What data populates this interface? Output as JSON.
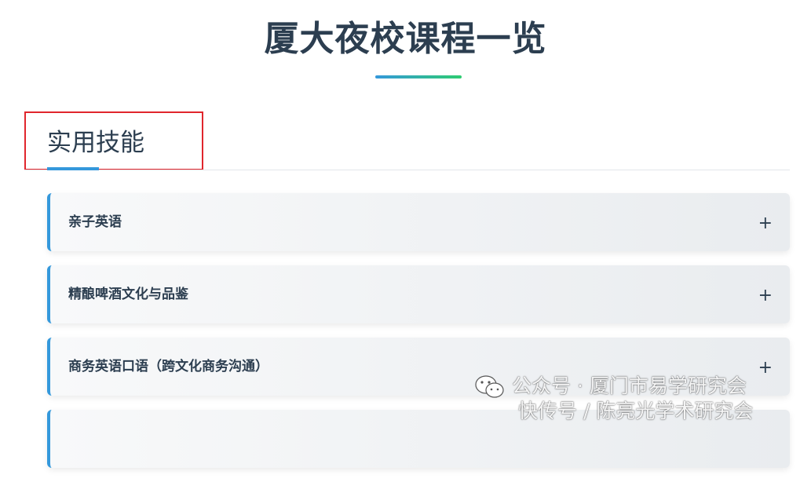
{
  "page": {
    "title": "厦大夜校课程一览"
  },
  "section": {
    "title": "实用技能"
  },
  "courses": [
    {
      "label": "亲子英语",
      "toggle": "+"
    },
    {
      "label": "精酿啤酒文化与品鉴",
      "toggle": "+"
    },
    {
      "label": "商务英语口语（跨文化商务沟通）",
      "toggle": "+"
    }
  ],
  "watermark": {
    "line1": "公众号 · 厦门市易学研究会",
    "line2": "快传号 / 陈亮光学术研究会"
  },
  "colors": {
    "title_text": "#2c3e50",
    "accent_blue": "#3498db",
    "accent_green": "#2ecc71",
    "highlight_red": "#e0262d",
    "card_bg_start": "#f8f9fa",
    "card_bg_end": "#e9ecef"
  },
  "icons": {
    "watermark_logo": "wechat-icon",
    "expand": "plus-icon"
  }
}
